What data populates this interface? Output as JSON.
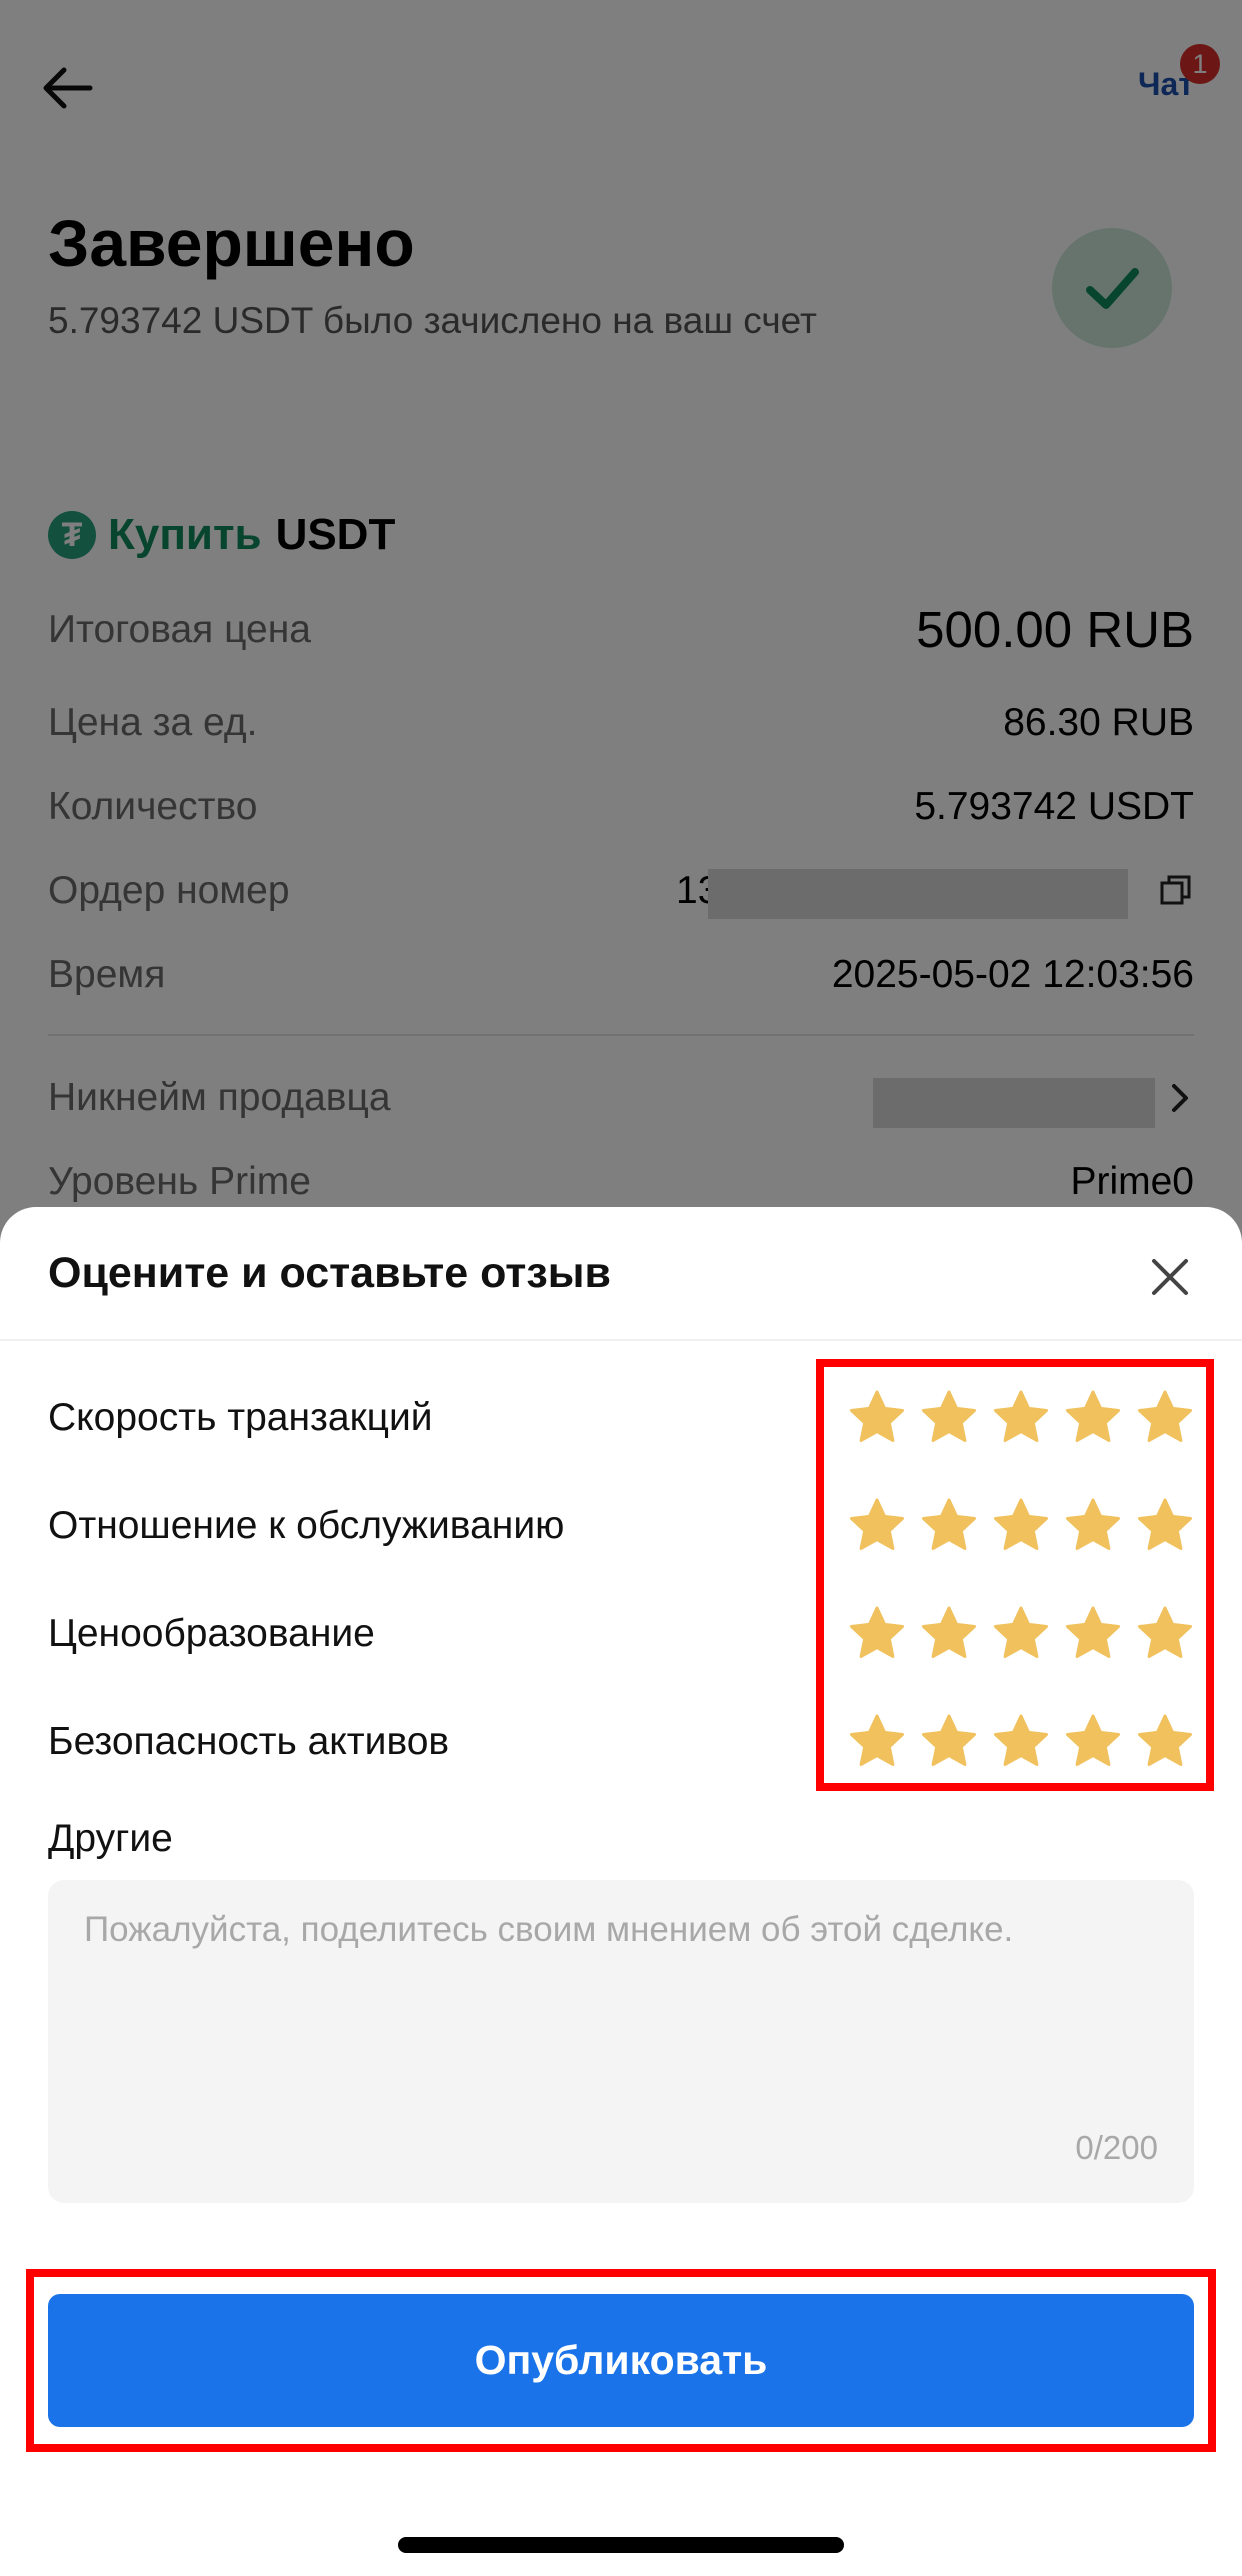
{
  "header": {
    "chat_label": "Чат",
    "chat_badge_count": "1"
  },
  "status": {
    "title": "Завершено",
    "subtitle": "5.793742 USDT было зачислено на ваш счет"
  },
  "order": {
    "side_label": "Купить",
    "asset": "USDT",
    "rows": [
      {
        "label": "Итоговая цена",
        "value": "500.00 RUB"
      },
      {
        "label": "Цена за ед.",
        "value": "86.30 RUB"
      },
      {
        "label": "Количество",
        "value": "5.793742 USDT"
      },
      {
        "label": "Ордер номер",
        "value": "13"
      },
      {
        "label": "Время",
        "value": "2025-05-02 12:03:56"
      }
    ],
    "seller_nickname_label": "Никнейм продавца",
    "prime_label": "Уровень Prime",
    "prime_value": "Prime0"
  },
  "review_sheet": {
    "title": "Оцените и оставьте отзыв",
    "ratings": [
      {
        "label": "Скорость транзакций",
        "stars": 5
      },
      {
        "label": "Отношение к обслуживанию",
        "stars": 5
      },
      {
        "label": "Ценообразование",
        "stars": 5
      },
      {
        "label": "Безопасность активов",
        "stars": 5
      }
    ],
    "other_label": "Другие",
    "comment_placeholder": "Пожалуйста, поделитесь своим мнением об этой сделке.",
    "comment_value": "",
    "char_count": "0/200",
    "publish_label": "Опубликовать"
  },
  "colors": {
    "star": "#f0c15c",
    "primary": "#1a73e8",
    "highlight": "#ff0000",
    "buy_green": "#0f8a5f"
  }
}
